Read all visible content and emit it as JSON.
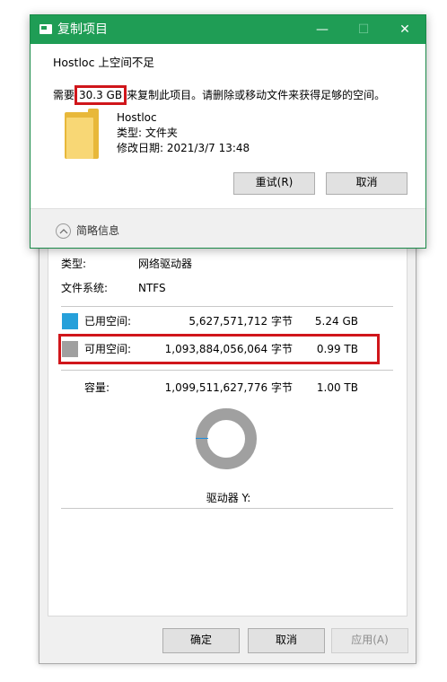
{
  "copy_dialog": {
    "title": "复制项目",
    "title_controls": [
      "—",
      "☐",
      "✕"
    ],
    "main_message": "Hostloc 上空间不足",
    "need_prefix": "需要",
    "need_size": "30.3 GB",
    "need_suffix": "来复制此项目。请删除或移动文件来获得足够的空间。",
    "file_name": "Hostloc",
    "file_type": "类型: 文件夹",
    "file_modified": "修改日期: 2021/3/7 13:48",
    "retry_label": "重试(R)",
    "cancel_label": "取消",
    "details_label": "简略信息"
  },
  "properties": {
    "type_label": "类型:",
    "type_value": "网络驱动器",
    "fs_label": "文件系统:",
    "fs_value": "NTFS",
    "used": {
      "label": "已用空间:",
      "bytes": "5,627,571,712 字节",
      "size": "5.24 GB",
      "color": "#26a0da"
    },
    "free": {
      "label": "可用空间:",
      "bytes": "1,093,884,056,064 字节",
      "size": "0.99 TB",
      "color": "#a0a0a0"
    },
    "capacity": {
      "label": "容量:",
      "bytes": "1,099,511,627,776 字节",
      "size": "1.00 TB"
    },
    "drive_label": "驱动器 Y:",
    "used_fraction": 0.005,
    "ok_label": "确定",
    "cancel_label": "取消",
    "apply_label": "应用(A)"
  }
}
